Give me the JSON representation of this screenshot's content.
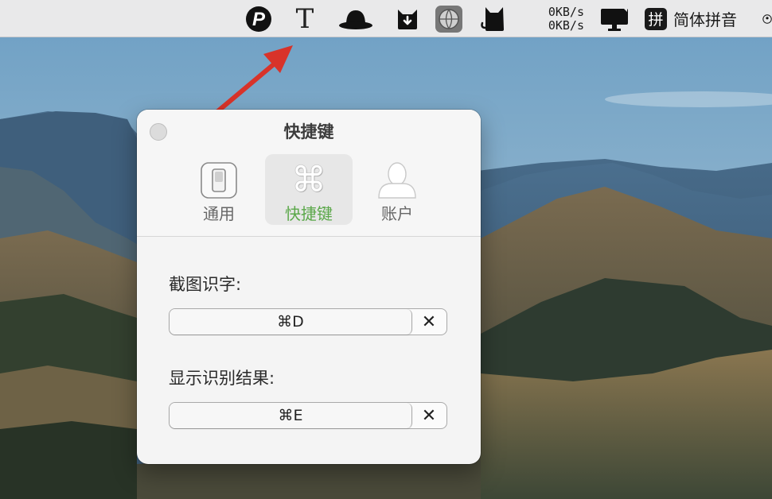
{
  "menubar": {
    "netspeed_up": "0KB/s",
    "netspeed_down": "0KB/s",
    "ime_badge": "拼",
    "ime_name": "简体拼音",
    "t_icon_glyph": "T",
    "icons": [
      "p-circle-icon",
      "text-recognition-t-icon",
      "bowler-hat-icon",
      "cat-download-icon",
      "globe-app-icon",
      "cat-silhouette-icon",
      "display-icon",
      "ime-badge-icon",
      "user-circle-icon"
    ]
  },
  "window": {
    "title": "快捷键",
    "tabs": [
      {
        "label": "通用",
        "icon": "switch-icon",
        "selected": false
      },
      {
        "label": "快捷键",
        "icon": "command-icon",
        "selected": true
      },
      {
        "label": "账户",
        "icon": "user-icon",
        "selected": false
      }
    ],
    "command_glyph": "⌘",
    "fields": [
      {
        "label": "截图识字:",
        "value": "⌘D",
        "clear": "✕"
      },
      {
        "label": "显示识别结果:",
        "value": "⌘E",
        "clear": "✕"
      }
    ]
  },
  "colors": {
    "accent_green": "#5ba84a",
    "arrow_red": "#d8332a",
    "menubar_bg": "#e9e9ea"
  }
}
